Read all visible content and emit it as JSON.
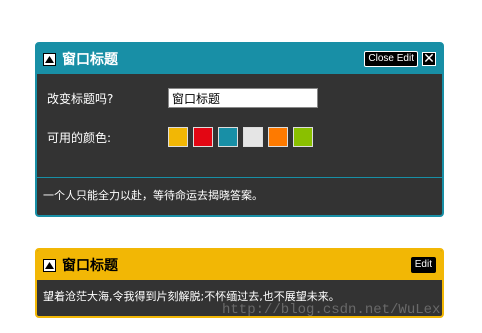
{
  "widgets": [
    {
      "title": "窗口标题",
      "header_color": "#188fa6",
      "edit_button": "Close Edit",
      "close_glyph": "✕",
      "collapse_icon": "triangle-up-icon",
      "edit_panel": {
        "title_label": "改变标题吗?",
        "title_value": "窗口标题",
        "colors_label": "可用的颜色:",
        "colors": [
          "#f2b705",
          "#e30613",
          "#188fa6",
          "#e5e5e5",
          "#fe7a00",
          "#8ac000"
        ]
      },
      "content": "一个人只能全力以赴，等待命运去揭晓答案。"
    },
    {
      "title": "窗口标题",
      "header_color": "#f2b705",
      "edit_button": "Edit",
      "collapse_icon": "triangle-up-icon",
      "content": "望着沧茫大海,令我得到片刻解脱;不怀缅过去,也不展望未来。"
    }
  ],
  "watermark": "http://blog.csdn.net/WuLex"
}
